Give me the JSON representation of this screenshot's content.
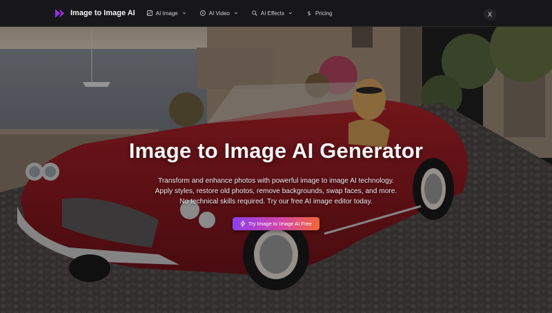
{
  "nav": {
    "brand": "Image to Image AI",
    "items": [
      {
        "label": "AI Image",
        "icon": "image-icon",
        "has_dropdown": true
      },
      {
        "label": "AI Video",
        "icon": "video-play-icon",
        "has_dropdown": true
      },
      {
        "label": "AI Effects",
        "icon": "wand-icon",
        "has_dropdown": true
      },
      {
        "label": "Pricing",
        "icon": "dollar-icon",
        "has_dropdown": false
      }
    ],
    "close_label": "X"
  },
  "hero": {
    "title": "Image to Image AI Generator",
    "description_lines": [
      "Transform and enhance photos with powerful image to image AI technology.",
      "Apply styles, restore old photos, remove backgrounds, swap faces, and more.",
      "No technical skills required. Try our free AI image editor today."
    ],
    "cta_label": "Try Image to Image AI Free"
  },
  "colors": {
    "nav_bg": "#17171a",
    "brand_accent": "#8b3ef0",
    "cta_gradient_start": "#8b3ef0",
    "cta_gradient_end": "#f2683a"
  }
}
